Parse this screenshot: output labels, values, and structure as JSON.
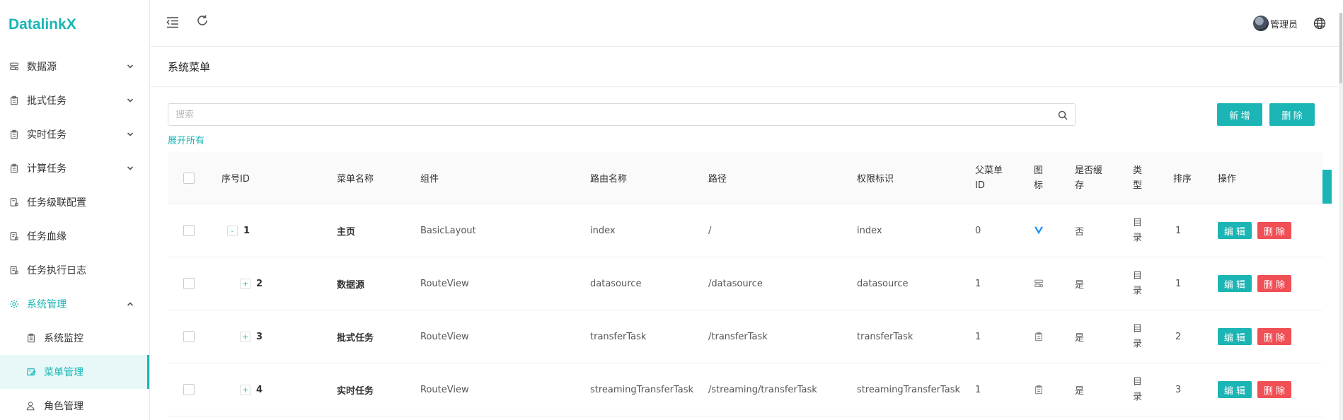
{
  "app": {
    "logo": "DatalinkX"
  },
  "sidebar": {
    "items": [
      {
        "label": "数据源",
        "icon": "database-icon",
        "chevron": "down"
      },
      {
        "label": "批式任务",
        "icon": "clipboard-icon",
        "chevron": "down"
      },
      {
        "label": "实时任务",
        "icon": "clipboard-icon",
        "chevron": "down"
      },
      {
        "label": "计算任务",
        "icon": "clipboard-icon",
        "chevron": "down"
      },
      {
        "label": "任务级联配置",
        "icon": "task-config-icon"
      },
      {
        "label": "任务血缘",
        "icon": "task-lineage-icon"
      },
      {
        "label": "任务执行日志",
        "icon": "task-log-icon"
      },
      {
        "label": "系统管理",
        "icon": "gear-icon",
        "chevron": "up",
        "open": true
      },
      {
        "label": "系统监控",
        "icon": "clipboard-icon",
        "sub": true
      },
      {
        "label": "菜单管理",
        "icon": "menu-edit-icon",
        "sub": true,
        "active": true
      },
      {
        "label": "角色管理",
        "icon": "user-icon",
        "sub": true
      }
    ]
  },
  "header": {
    "user_name": "管理员"
  },
  "page": {
    "title": "系统菜单"
  },
  "search": {
    "placeholder": "搜索",
    "value": ""
  },
  "expand_all": "展开所有",
  "toolbar": {
    "add_label": "新 增",
    "delete_label": "删 除"
  },
  "table": {
    "headers": {
      "id": "序号ID",
      "name": "菜单名称",
      "component": "组件",
      "route_name": "路由名称",
      "path": "路径",
      "permission": "权限标识",
      "parent_id": "父菜单ID",
      "icon": "图标",
      "cache": "是否缓存",
      "type": "类型",
      "sort": "排序",
      "actions": "操作"
    },
    "rows": [
      {
        "expander": "-",
        "id": "1",
        "name": "主页",
        "component": "BasicLayout",
        "route_name": "index",
        "path": "/",
        "permission": "index",
        "parent_id": "0",
        "icon": "vuejs-icon",
        "cache": "否",
        "type": "目录",
        "sort": "1"
      },
      {
        "expander": "+",
        "id": "2",
        "name": "数据源",
        "component": "RouteView",
        "route_name": "datasource",
        "path": "/datasource",
        "permission": "datasource",
        "parent_id": "1",
        "icon": "database-icon",
        "cache": "是",
        "type": "目录",
        "sort": "1"
      },
      {
        "expander": "+",
        "id": "3",
        "name": "批式任务",
        "component": "RouteView",
        "route_name": "transferTask",
        "path": "/transferTask",
        "permission": "transferTask",
        "parent_id": "1",
        "icon": "clipboard-icon",
        "cache": "是",
        "type": "目录",
        "sort": "2"
      },
      {
        "expander": "+",
        "id": "4",
        "name": "实时任务",
        "component": "RouteView",
        "route_name": "streamingTransferTask",
        "path": "/streaming/transferTask",
        "permission": "streamingTransferTask",
        "parent_id": "1",
        "icon": "clipboard-icon",
        "cache": "是",
        "type": "目录",
        "sort": "3"
      }
    ],
    "edit_label": "编 辑",
    "delete_label": "删 除"
  },
  "colors": {
    "accent": "#1bb5b5",
    "danger": "#f04f55"
  }
}
